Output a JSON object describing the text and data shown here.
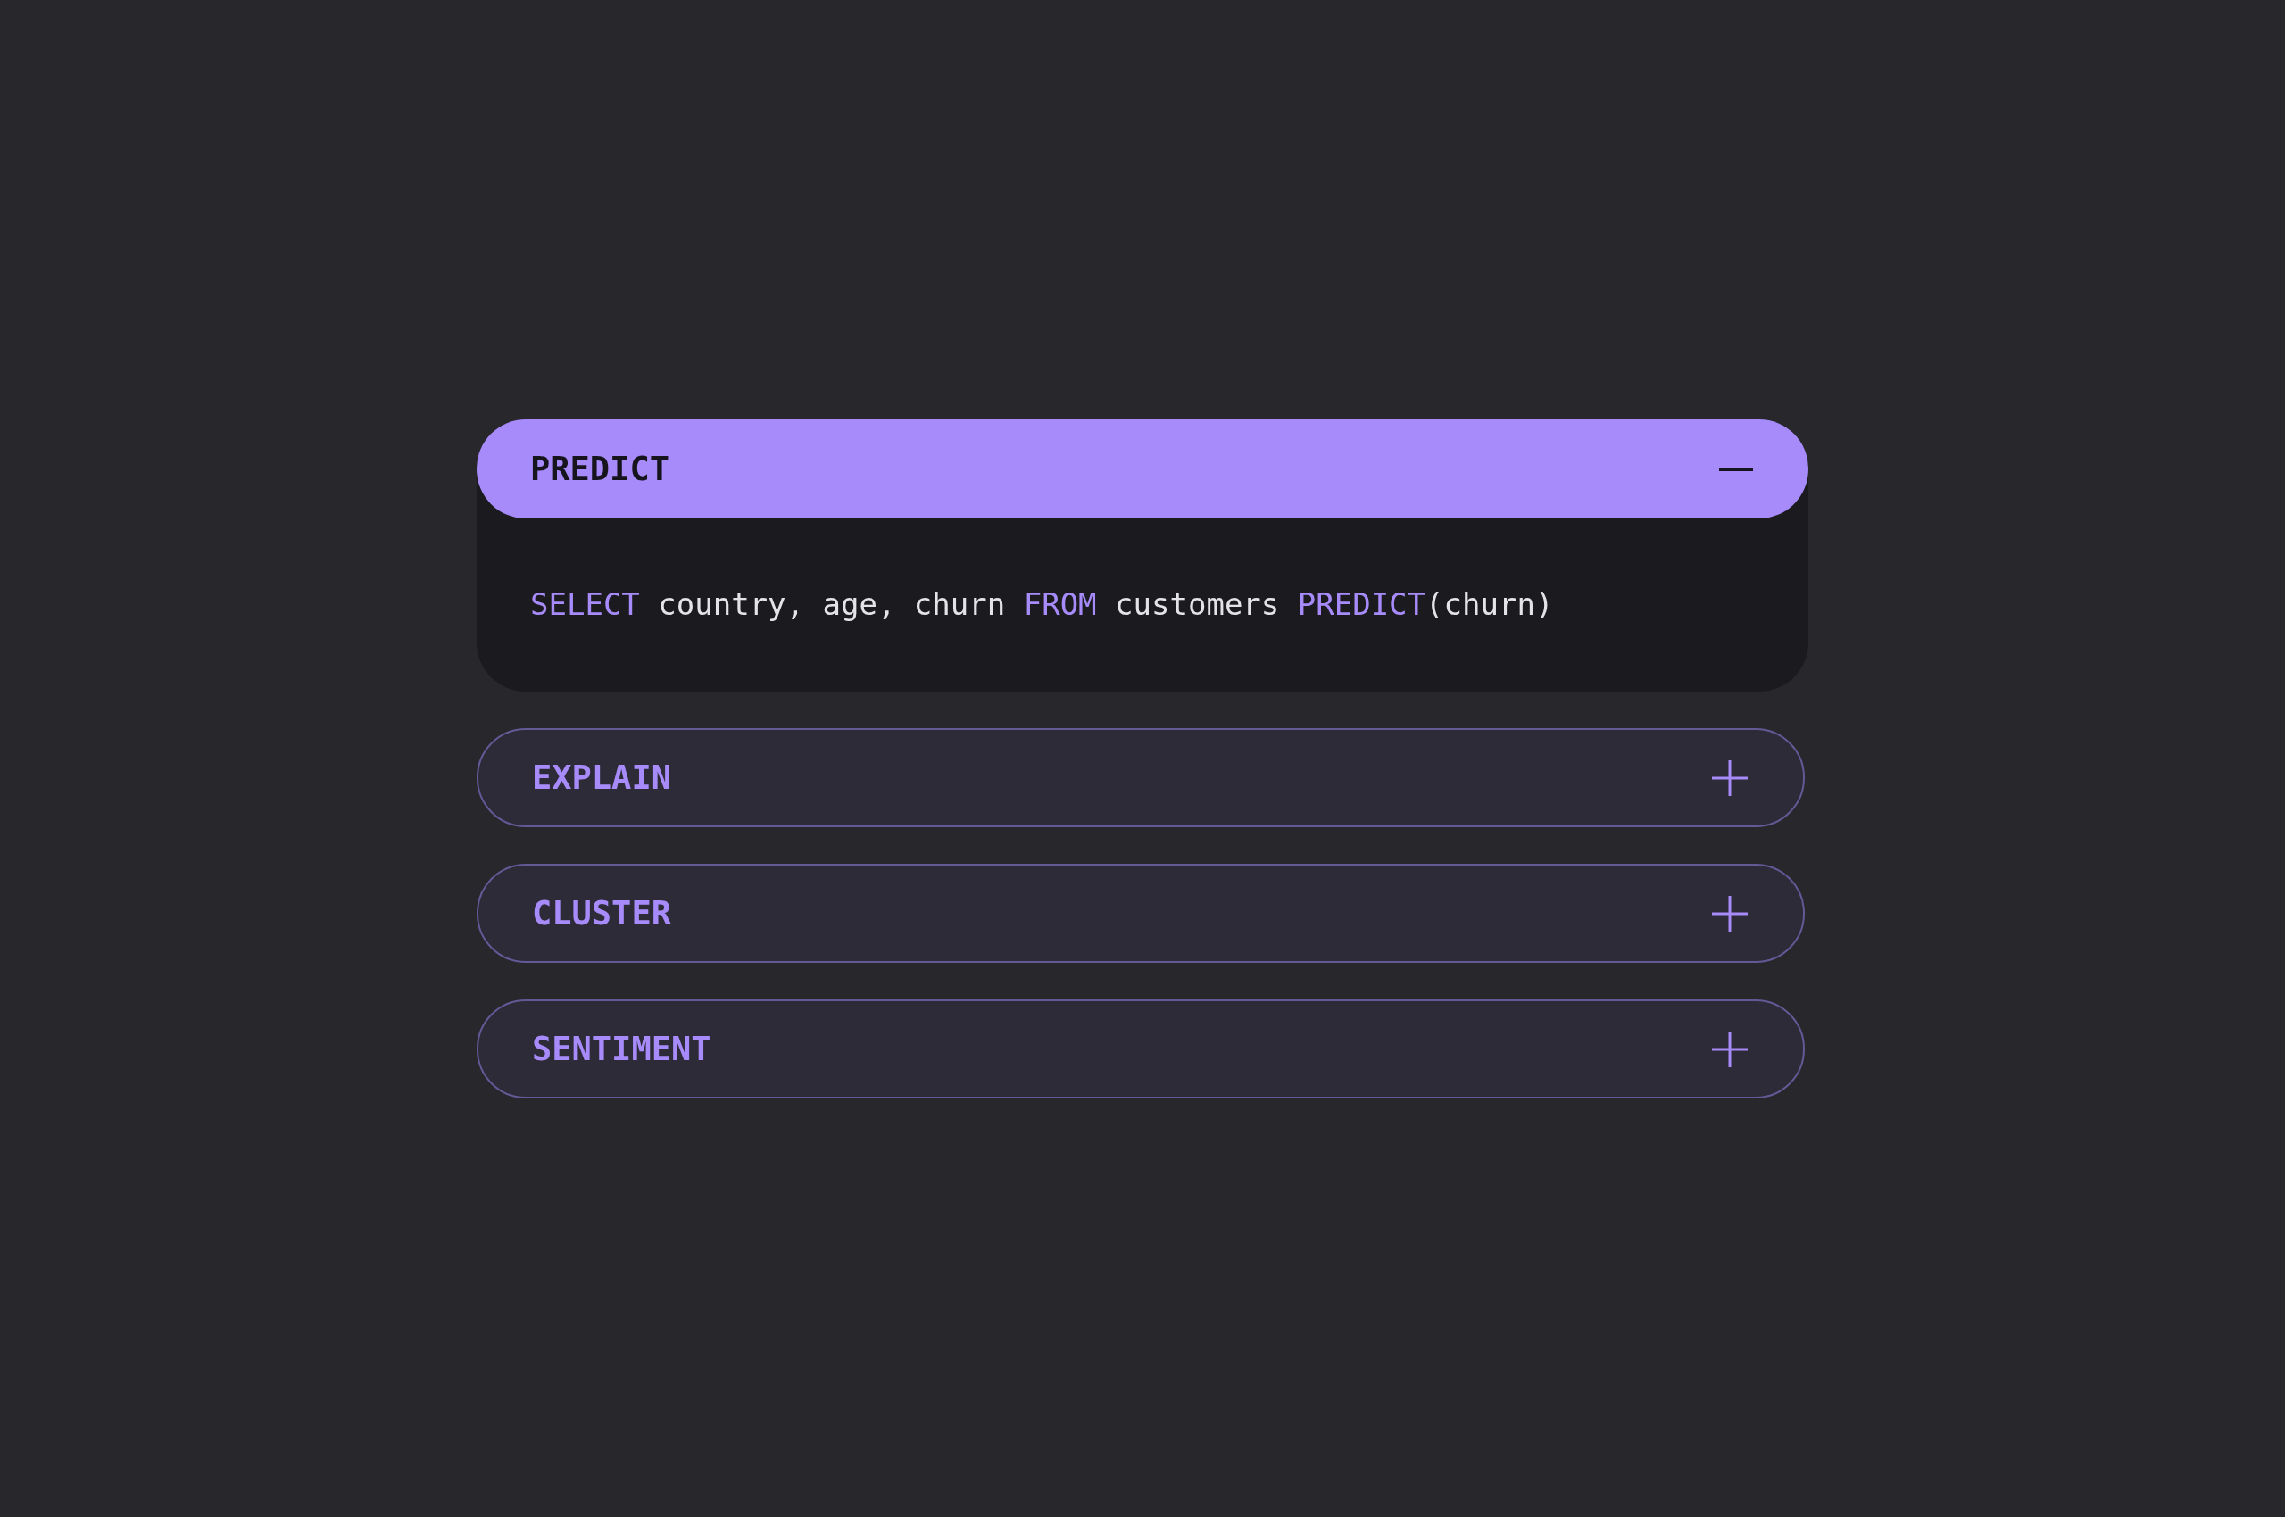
{
  "accordion": [
    {
      "title": "PREDICT",
      "expanded": true,
      "code": [
        {
          "text": "SELECT",
          "kind": "keyword"
        },
        {
          "text": " country, age, churn ",
          "kind": "plain"
        },
        {
          "text": "FROM",
          "kind": "keyword"
        },
        {
          "text": " customers ",
          "kind": "plain"
        },
        {
          "text": "PREDICT",
          "kind": "keyword"
        },
        {
          "text": "(churn)",
          "kind": "plain"
        }
      ]
    },
    {
      "title": "EXPLAIN",
      "expanded": false
    },
    {
      "title": "CLUSTER",
      "expanded": false
    },
    {
      "title": "SENTIMENT",
      "expanded": false
    }
  ]
}
